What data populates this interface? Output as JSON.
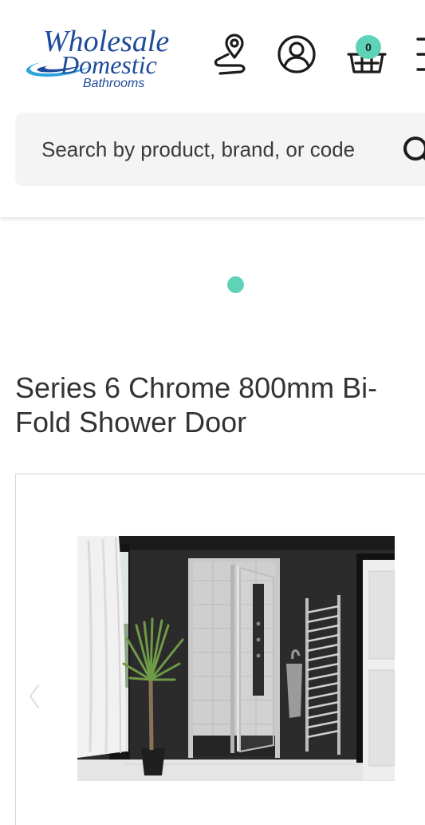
{
  "brand": {
    "line1": "Wholesale",
    "line2": "Domestic",
    "line3": "Bathrooms",
    "color": "#1e4b99",
    "swoosh_color": "#2aa3dd"
  },
  "header": {
    "icons": [
      "store-locator-icon",
      "account-icon",
      "basket-icon",
      "menu-icon"
    ],
    "cart_count": "0"
  },
  "search": {
    "placeholder": "Search by product, brand, or code"
  },
  "carousel": {
    "active_dot_color": "#5ed3b8"
  },
  "product": {
    "title": "Series 6 Chrome 800mm Bi-Fold Shower Door"
  },
  "colors": {
    "accent": "#5ed3b8",
    "text": "#333333",
    "search_bg": "#f4f4f4"
  }
}
